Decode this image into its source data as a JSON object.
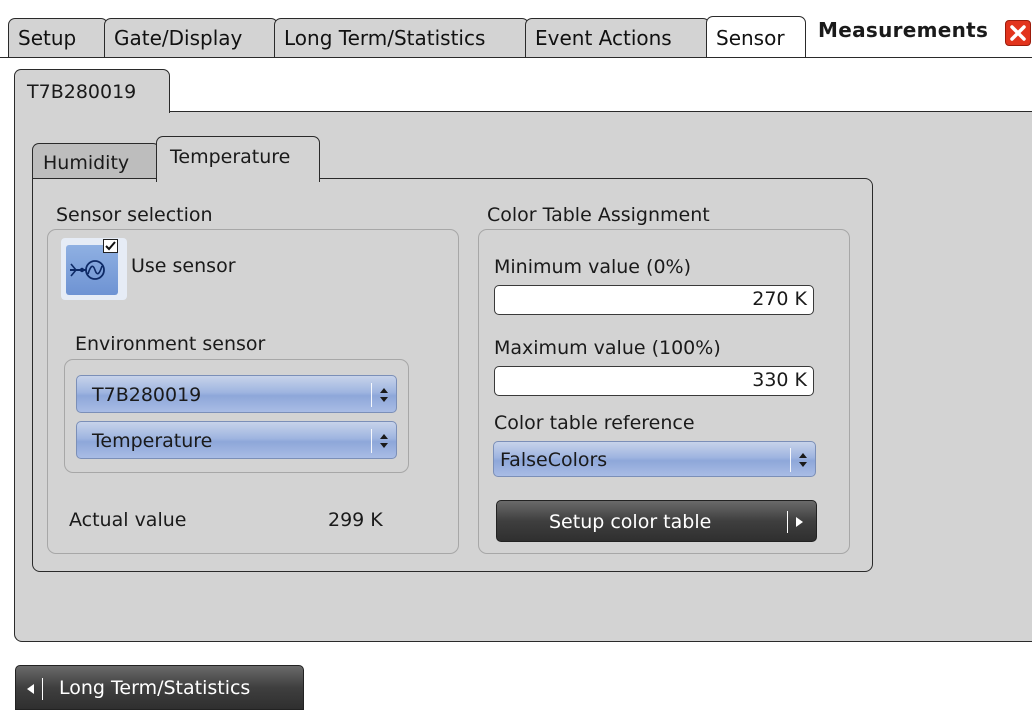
{
  "top_tabs": [
    "Setup",
    "Gate/Display",
    "Long Term/Statistics",
    "Event Actions",
    "Sensor"
  ],
  "dialog_title": "Measurements",
  "sensor_tab": "T7B280019",
  "inner_tabs": [
    "Humidity",
    "Temperature"
  ],
  "sensor_selection": {
    "heading": "Sensor selection",
    "use_sensor_label": "Use sensor",
    "use_sensor_checked": true,
    "env_label": "Environment sensor",
    "sensor_value": "T7B280019",
    "quantity_value": "Temperature",
    "actual_label": "Actual value",
    "actual_value": "299 K"
  },
  "color_table": {
    "heading": "Color Table Assignment",
    "min_label": "Minimum value (0%)",
    "min_value": "270 K",
    "max_label": "Maximum value (100%)",
    "max_value": "330 K",
    "ref_label": "Color table reference",
    "ref_value": "FalseColors",
    "setup_button": "Setup color table"
  },
  "bottom_nav": {
    "back_label": "Long Term/Statistics"
  },
  "colors": {
    "panel_bg": "#d3d3d3",
    "combo_blue": "#9fb5e0",
    "close_red": "#e2341d"
  }
}
